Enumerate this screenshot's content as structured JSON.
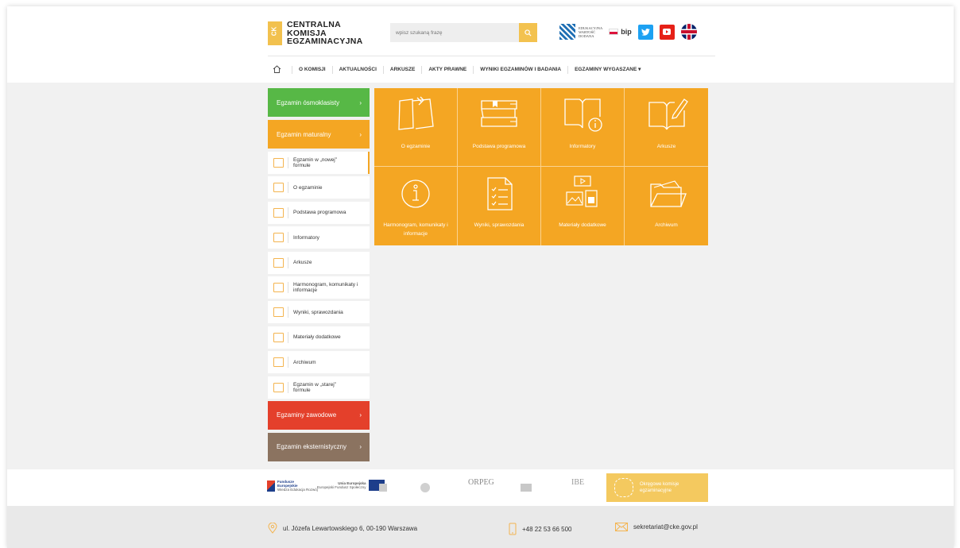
{
  "header": {
    "logo_lines": [
      "CENTRALNA",
      "KOMISJA",
      "EGZAMINACYJNA"
    ],
    "search_placeholder": "wpisz szukaną frazę",
    "ewd_lines": [
      "EDUKACYJNA",
      "WARTOŚĆ",
      "DODANA"
    ],
    "bip_label": "bip"
  },
  "nav": {
    "items": [
      "O KOMISJI",
      "AKTUALNOŚCI",
      "ARKUSZE",
      "AKTY PRAWNE",
      "WYNIKI EGZAMINÓW I BADANIA",
      "EGZAMINY WYGASZANE ▾"
    ]
  },
  "sidebar": {
    "main": [
      {
        "label": "Egzamin ósmoklasisty",
        "arrow": "›"
      },
      {
        "label": "Egzamin maturalny",
        "arrow": "›"
      }
    ],
    "sub": [
      "Egzamin w „nowej” formule",
      "O egzaminie",
      "Podstawa programowa",
      "Informatory",
      "Arkusze",
      "Harmonogram, komunikaty i informacje",
      "Wyniki, sprawozdania",
      "Materiały dodatkowe",
      "Archiwum",
      "Egzamin w „starej” formule"
    ],
    "bottom": [
      {
        "label": "Egzaminy zawodowe",
        "arrow": "›"
      },
      {
        "label": "Egzamin eksternistyczny",
        "arrow": "›"
      }
    ]
  },
  "tiles": [
    "O egzaminie",
    "Podstawa programowa",
    "Informatory",
    "Arkusze",
    "Harmonogram, komunikaty i informacje",
    "Wyniki, sprawozdania",
    "Materiały dodatkowe",
    "Archiwum"
  ],
  "partners": {
    "fe_lines": [
      "Fundusze",
      "Europejskie",
      "Wiedza Edukacja Rozwój"
    ],
    "ue_lines": [
      "Unia Europejska",
      "Europejski Fundusz Społeczny"
    ],
    "orpeg": "ORPEG",
    "ibe": "IBE",
    "okregowe_lines": [
      "Okręgowe komisje",
      "egzaminacyjne"
    ]
  },
  "footer": {
    "address": "ul. Józefa Lewartowskiego 6, 00-190 Warszawa",
    "phone": "+48 22 53 66 500",
    "email": "sekretariat@cke.gov.pl"
  },
  "colors": {
    "accent": "#f4a623",
    "green": "#57b846",
    "red": "#e4402b",
    "brown": "#8b7360"
  }
}
